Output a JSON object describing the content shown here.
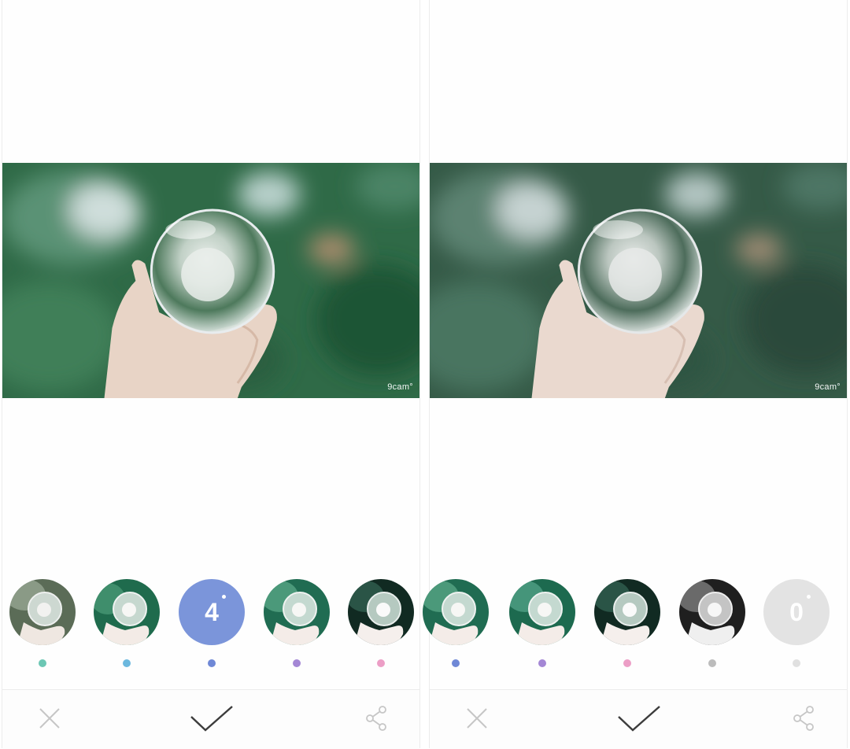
{
  "app": {
    "watermark": "9cam°"
  },
  "colors": {
    "selected_fill": "#7b95da",
    "inactive_fill": "#e3e3e3",
    "icon_gray": "#c6c6c6",
    "check_dark": "#3c3c3c"
  },
  "screens": [
    {
      "filters": [
        {
          "type": "thumbnail",
          "tone": "muted",
          "dot_color": "#6cc7b4"
        },
        {
          "type": "thumbnail",
          "tone": "teal",
          "dot_color": "#6cb8de"
        },
        {
          "type": "selected",
          "label": "4",
          "dot_color": "#6f88d6"
        },
        {
          "type": "thumbnail",
          "tone": "teal",
          "dot_color": "#a487d5"
        },
        {
          "type": "thumbnail",
          "tone": "dark",
          "dot_color": "#ec9ec6"
        }
      ],
      "toolbar": {
        "close_icon": "close-icon",
        "confirm_icon": "check-icon",
        "share_icon": "share-icon"
      }
    },
    {
      "filters": [
        {
          "type": "thumbnail",
          "tone": "teal",
          "dot_color": "#6f88d6"
        },
        {
          "type": "thumbnail",
          "tone": "teal",
          "dot_color": "#a487d5"
        },
        {
          "type": "thumbnail",
          "tone": "dark",
          "dot_color": "#ec9ec6"
        },
        {
          "type": "thumbnail",
          "tone": "mono",
          "dot_color": "#bcbcbc"
        },
        {
          "type": "inactive",
          "label": "0",
          "dot_color": "#e0e0e0"
        }
      ],
      "toolbar": {
        "close_icon": "close-icon",
        "confirm_icon": "check-icon",
        "share_icon": "share-icon"
      }
    }
  ]
}
